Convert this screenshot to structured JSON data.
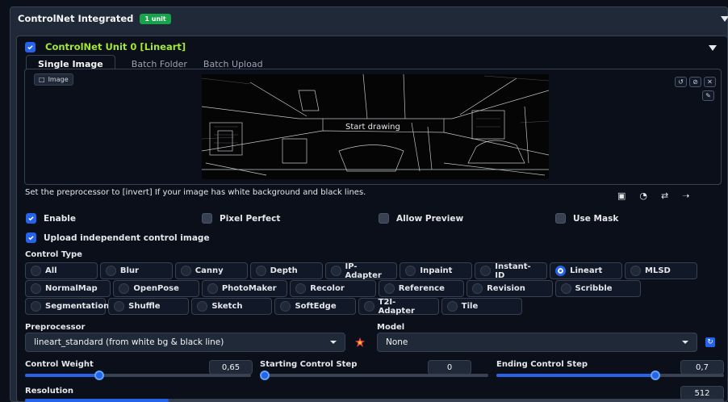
{
  "header": {
    "title": "ControlNet Integrated",
    "badge": "1 unit"
  },
  "unit": {
    "title": "ControlNet Unit 0 [Lineart]",
    "enabled": true
  },
  "tabs": [
    {
      "label": "Single Image",
      "active": true
    },
    {
      "label": "Batch Folder",
      "active": false
    },
    {
      "label": "Batch Upload",
      "active": false
    }
  ],
  "image_panel": {
    "label": "Image",
    "overlay_text": "Start drawing"
  },
  "hint": "Set the preprocessor to [invert] If your image has white background and black lines.",
  "options": {
    "enable": {
      "label": "Enable",
      "checked": true
    },
    "pixel_perfect": {
      "label": "Pixel Perfect",
      "checked": false
    },
    "allow_preview": {
      "label": "Allow Preview",
      "checked": false
    },
    "use_mask": {
      "label": "Use Mask",
      "checked": false
    },
    "upload_independent": {
      "label": "Upload independent control image",
      "checked": true
    }
  },
  "control_type": {
    "label": "Control Type",
    "selected": "Lineart",
    "rows": [
      [
        "All",
        "Blur",
        "Canny",
        "Depth",
        "IP-Adapter",
        "Inpaint",
        "Instant-ID",
        "Lineart",
        "MLSD"
      ],
      [
        "NormalMap",
        "OpenPose",
        "PhotoMaker",
        "Recolor",
        "Reference",
        "Revision",
        "Scribble"
      ],
      [
        "Segmentation",
        "Shuffle",
        "Sketch",
        "SoftEdge",
        "T2I-Adapter",
        "Tile"
      ]
    ]
  },
  "preprocessor": {
    "label": "Preprocessor",
    "value": "lineart_standard (from white bg & black line)"
  },
  "model": {
    "label": "Model",
    "value": "None"
  },
  "sliders": {
    "control_weight": {
      "label": "Control Weight",
      "value": "0,65",
      "fraction": 0.33
    },
    "starting_step": {
      "label": "Starting Control Step",
      "value": "0",
      "fraction": 0.0
    },
    "ending_step": {
      "label": "Ending Control Step",
      "value": "0,7",
      "fraction": 0.7
    },
    "resolution": {
      "label": "Resolution",
      "value": "512"
    }
  },
  "colors": {
    "accent": "#2563eb",
    "unit_title": "#a3e635",
    "badge": "#16a34a",
    "panel": "#1f2937",
    "bg": "#0b0f19"
  }
}
